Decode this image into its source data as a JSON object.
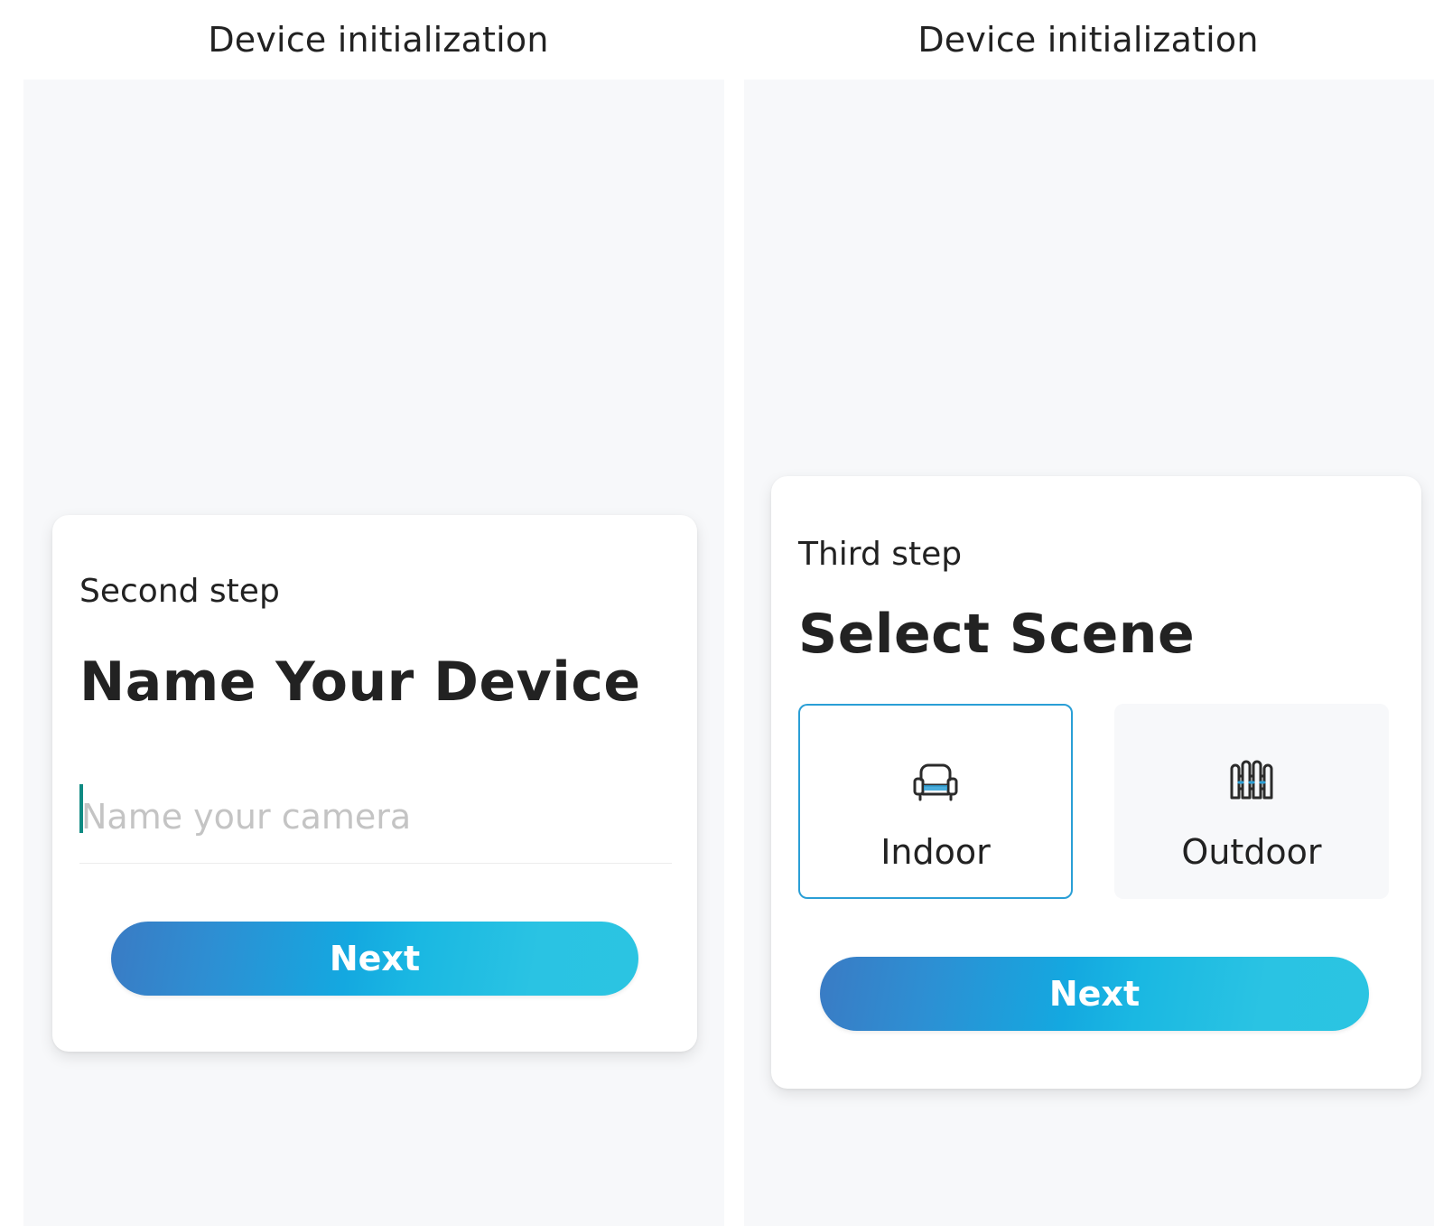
{
  "left_screen": {
    "header_title": "Device initialization",
    "card": {
      "step_label": "Second step",
      "heading": "Name Your Device",
      "name_input": {
        "value": "",
        "placeholder": "Name your camera"
      },
      "next_label": "Next"
    }
  },
  "right_screen": {
    "header_title": "Device initialization",
    "card": {
      "step_label": "Third step",
      "heading": "Select Scene",
      "scenes": [
        {
          "label": "Indoor",
          "icon": "armchair-icon",
          "selected": true
        },
        {
          "label": "Outdoor",
          "icon": "fence-icon",
          "selected": false
        }
      ],
      "next_label": "Next"
    }
  },
  "colors": {
    "background": "#f7f8fa",
    "card": "#ffffff",
    "text": "#222222",
    "placeholder": "#c4c4c4",
    "caret": "#0f8a82",
    "selected_border": "#2a9fd6",
    "button_gradient_start": "#3a7bc4",
    "button_gradient_end": "#2bc4e2"
  }
}
